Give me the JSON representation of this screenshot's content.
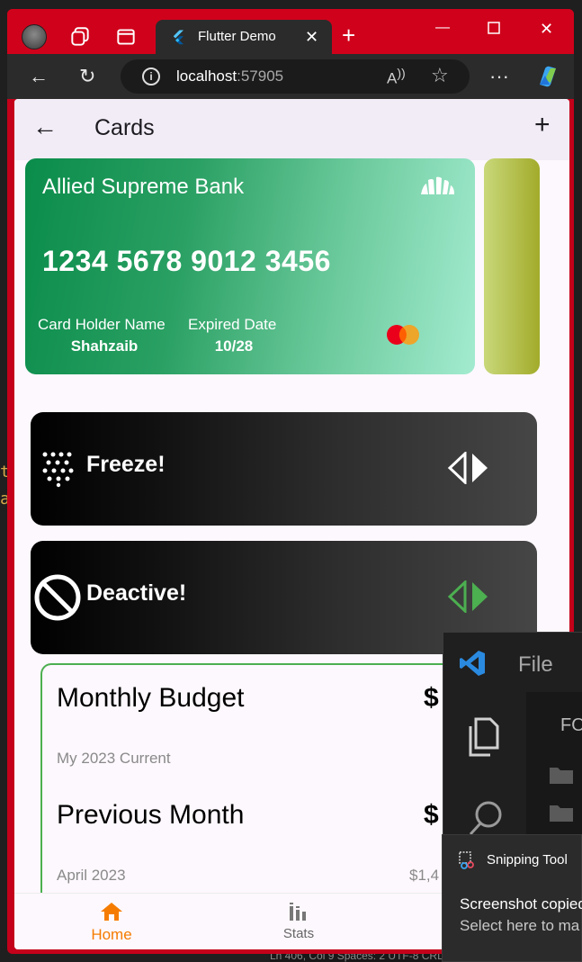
{
  "browser": {
    "tab_title": "Flutter Demo",
    "url_host": "localhost",
    "url_port": ":57905"
  },
  "app": {
    "title": "Cards"
  },
  "card": {
    "bank_name": "Allied Supreme Bank",
    "number": "1234 5678 9012 3456",
    "holder_label": "Card Holder Name",
    "holder_value": "Shahzaib",
    "expiry_label": "Expired Date",
    "expiry_value": "10/28",
    "colors": {
      "start": "#0a8c4a",
      "end": "#a3ebd0"
    }
  },
  "actions": {
    "freeze_label": "Freeze!",
    "deactive_label": "Deactive!",
    "freeze_arrow_color": "#ffffff",
    "deactive_arrow_color": "#4caf50"
  },
  "budget": {
    "title": "Monthly Budget",
    "amount": "$",
    "subtitle": "My 2023 Current",
    "prev_title": "Previous Month",
    "prev_amount": "$",
    "prev_subtitle": "April 2023",
    "prev_value": "$1,4"
  },
  "bottom_nav": {
    "home_label": "Home",
    "stats_label": "Stats",
    "active_color": "#f57c00"
  },
  "vscode": {
    "menu_file": "File",
    "explorer_header": "FO"
  },
  "snipping": {
    "app_name": "Snipping Tool",
    "message": "Screenshot copied",
    "sub_message": "Select here to ma"
  },
  "statusbar": {
    "text": "Ln 406, Col 9   Spaces: 2   UTF-8   CRLF"
  }
}
